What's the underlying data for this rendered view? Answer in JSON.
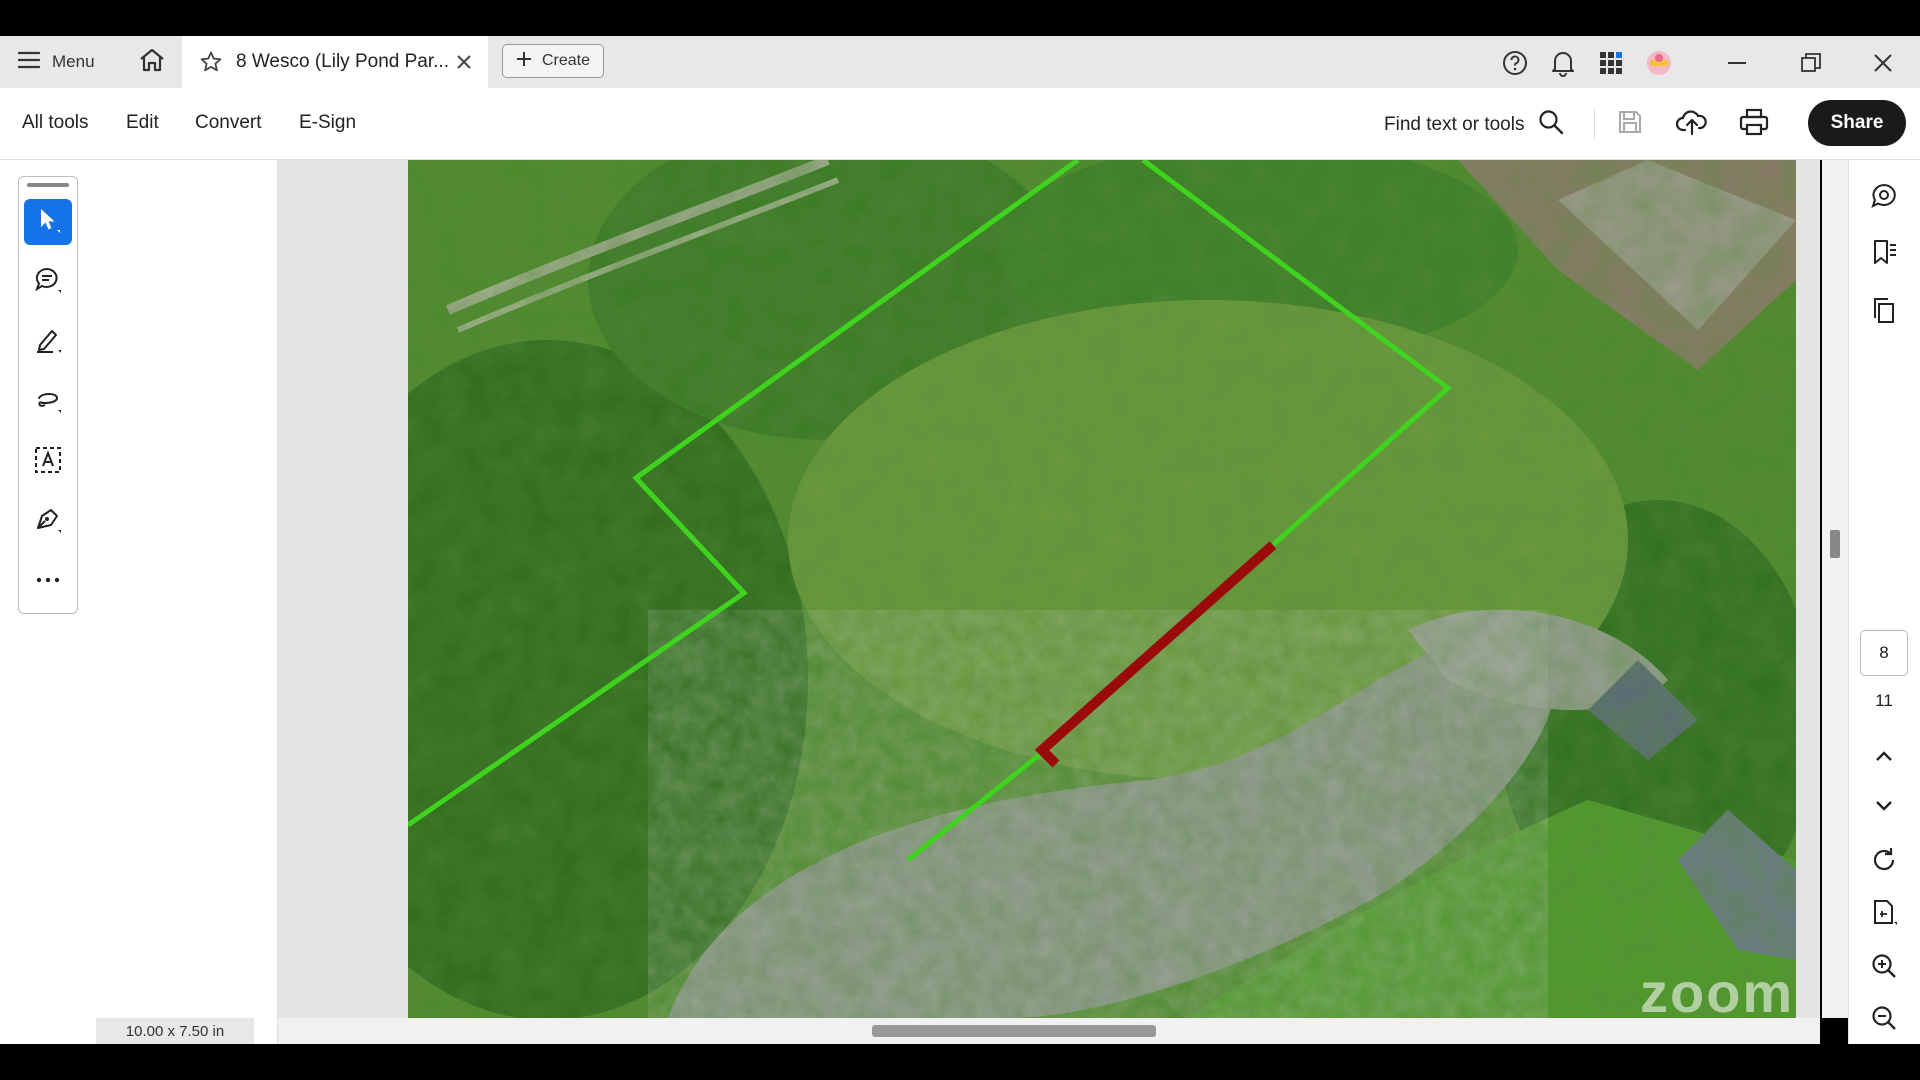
{
  "tabbar": {
    "menu_label": "Menu",
    "doc_tab_title": "8 Wesco (Lily Pond Par...",
    "create_label": "Create",
    "icons": [
      "menu-icon",
      "home-icon",
      "star-icon",
      "close-icon",
      "plus-icon",
      "help-icon",
      "bell-icon",
      "apps-icon",
      "avatar",
      "minimize-icon",
      "restore-icon",
      "close-window-icon"
    ]
  },
  "toolbar": {
    "menus": [
      "All tools",
      "Edit",
      "Convert",
      "E-Sign"
    ],
    "find_label": "Find text or tools",
    "share_label": "Share"
  },
  "left_tools": [
    "select-tool",
    "comment-tool",
    "highlight-tool",
    "draw-tool",
    "text-recognition-tool",
    "sign-tool",
    "more-tools"
  ],
  "status": {
    "page_size": "10.00 x 7.50 in"
  },
  "page_nav": {
    "current_page": "8",
    "total_pages": "11"
  },
  "watermark_text": "zoom",
  "colors": {
    "accent": "#1473e6",
    "boundary_line": "#3fd21f",
    "highlight_line": "#9b0a0a"
  }
}
